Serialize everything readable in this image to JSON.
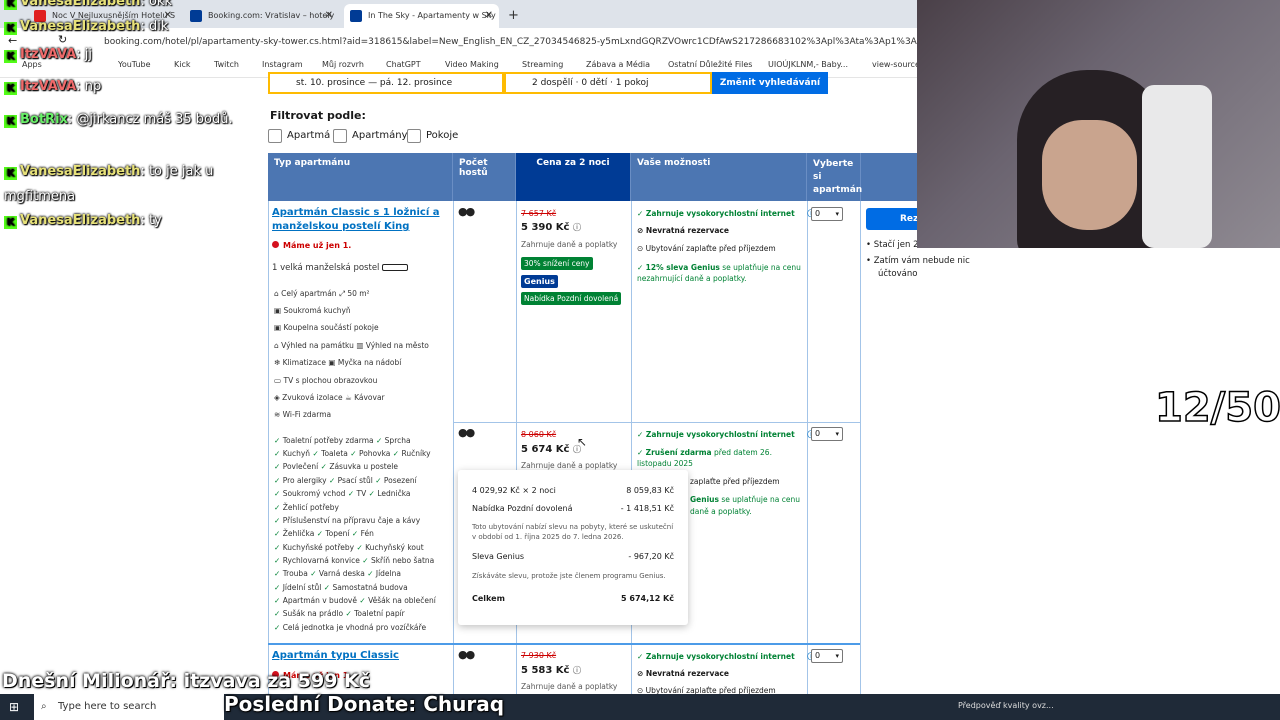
{
  "browser": {
    "tabs": [
      {
        "label": "Noc V Nejluxusnějším Hotelu S",
        "color": "#e02020"
      },
      {
        "label": "Booking.com: Vratislav – hotely",
        "color": "#003b95"
      },
      {
        "label": "In The Sky - Apartamenty w Sky",
        "color": "#003b95"
      }
    ],
    "new_tab": "+",
    "url": "booking.com/hotel/pl/apartamenty-sky-tower.cs.html?aid=318615&label=New_English_EN_CZ_27034546825-y5mLxndGQRZVOwrc1CDfAwS217286683102%3Apl%3Ata%3Ap1%3Ap2%3Aac%3Aap",
    "bookmarks": [
      "Apps",
      "YouTube",
      "Kick",
      "Twitch",
      "Instagram",
      "Můj rozvrh",
      "ChatGPT",
      "Video Making",
      "Streaming",
      "Zábava a Média",
      "Ostatní Důležité Files",
      "UIOÚJKLNM,- Baby...",
      "view-source:"
    ]
  },
  "search": {
    "dates": "st. 10. prosince — pá. 12. prosince",
    "guests": "2 dospělí · 0 dětí · 1 pokoj",
    "button": "Změnit vyhledávání"
  },
  "filter": {
    "title": "Filtrovat podle:",
    "options": [
      "Apartmá",
      "Apartmány",
      "Pokoje"
    ]
  },
  "table": {
    "headers": [
      "Typ apartmánu",
      "Počet hostů",
      "Cena za 2 noci",
      "Vaše možnosti",
      "Vyberte si apartmán"
    ]
  },
  "rooms": [
    {
      "title": "Apartmán Classic s 1 ložnicí a manželskou postelí King",
      "scarcity": "Máme už jen 1.",
      "bed": "1 velká manželská postel",
      "features": [
        "Celý apartmán",
        "50 m²",
        "Soukromá kuchyň",
        "Koupelna součástí pokoje",
        "Výhled na památku",
        "Výhled na město",
        "Klimatizace",
        "Myčka na nádobí",
        "TV s plochou obrazovkou",
        "Zvuková izolace",
        "Kávovar",
        "Wi-Fi zdarma"
      ],
      "old_price": "7 657 Kč",
      "price": "5 390 Kč",
      "included": "Zahrnuje daně a poplatky",
      "badges": [
        "30% snížení ceny",
        "Genius",
        "Nabídka Pozdní dovolená"
      ],
      "options": [
        "Zahrnuje vysokorychlostní internet",
        "Nevratná rezervace",
        "Ubytování zaplaťte před příjezdem",
        "12% sleva Genius",
        "se uplatňuje na cenu nezahrnující daně a poplatky."
      ],
      "select": "0"
    },
    {
      "old_price": "8 060 Kč",
      "price": "5 674 Kč",
      "included": "Zahrnuje daně a poplatky",
      "options": [
        "Zahrnuje vysokorychlostní internet",
        "Zrušení zdarma",
        "před datem 26. listopadu 2025",
        "zaplaťte před příjezdem",
        "Genius",
        "se uplatňuje na cenu",
        "daně a poplatky."
      ],
      "select": "0",
      "amenities": [
        [
          "Toaletní potřeby zdarma",
          "Sprcha"
        ],
        [
          "Kuchyň",
          "Toaleta",
          "Pohovka",
          "Ručníky"
        ],
        [
          "Povlečení",
          "Zásuvka u postele"
        ],
        [
          "Pro alergiky",
          "Psací stůl",
          "Posezení"
        ],
        [
          "Soukromý vchod",
          "TV",
          "Lednička"
        ],
        [
          "Žehlicí potřeby"
        ],
        [
          "Příslušenství na přípravu čaje a kávy"
        ],
        [
          "Žehlička",
          "Topení",
          "Fén"
        ],
        [
          "Kuchyňské potřeby",
          "Kuchyňský kout"
        ],
        [
          "Rychlovarná konvice",
          "Skříň nebo šatna"
        ],
        [
          "Trouba",
          "Varná deska",
          "Jídelna"
        ],
        [
          "Jídelní stůl",
          "Samostatná budova"
        ],
        [
          "Apartmán v budově",
          "Věšák na oblečení"
        ],
        [
          "Sušák na prádlo",
          "Toaletní papír"
        ],
        [
          "Celá jednotka je vhodná pro vozíčkáře"
        ]
      ]
    },
    {
      "title": "Apartmán typu Classic",
      "scarcity": "Máme už jen 1.",
      "old_price": "7 930 Kč",
      "price": "5 583 Kč",
      "included": "Zahrnuje daně a poplatky",
      "options": [
        "Zahrnuje vysokorychlostní internet",
        "Nevratná rezervace",
        "Ubytování zaplaťte před příjezdem"
      ],
      "select": "0"
    }
  ],
  "popup": {
    "row1_label": "4 029,92 Kč × 2 noci",
    "row1_value": "8 059,83 Kč",
    "row2_label": "Nabídka Pozdní dovolená",
    "row2_value": "- 1 418,51 Kč",
    "note1": "Toto ubytování nabízí slevu na pobyty, které se uskuteční v období od 1. října 2025 do 7. ledna 2026.",
    "row3_label": "Sleva Genius",
    "row3_value": "- 967,20 Kč",
    "note2": "Získáváte slevu, protože jste členem programu Genius.",
    "total_label": "Celkem",
    "total_value": "5 674,12 Kč"
  },
  "right_panel": {
    "reserve_button": "Reze",
    "bullets": [
      "Stačí jen 2",
      "Zatím vám nebude nic",
      "účtováno"
    ]
  },
  "chat": [
    {
      "user": "VanesaElizabeth",
      "msg": ": okk"
    },
    {
      "user": "VanesaElizabeth",
      "msg": ": dik"
    },
    {
      "user": "ItzVAVA",
      "msg": ": jj"
    },
    {
      "user": "ItzVAVA",
      "msg": ": np"
    },
    {
      "user": "BotRix",
      "msg": ": @jirkancz máš 35 bodů."
    },
    {
      "user": "VanesaElizabeth",
      "msg": ": to je jak u mgfitmena"
    },
    {
      "user": "VanesaElizabeth",
      "msg": ": ty"
    }
  ],
  "overlay": {
    "counter": "12/50",
    "millionaire": "Dnešní Milionář: itzvava za 599 Kč",
    "last_donate": "Poslední Donate: Churaq"
  },
  "taskbar": {
    "search_placeholder": "Type here to search",
    "notification": "Předpověď kvality ovz..."
  }
}
